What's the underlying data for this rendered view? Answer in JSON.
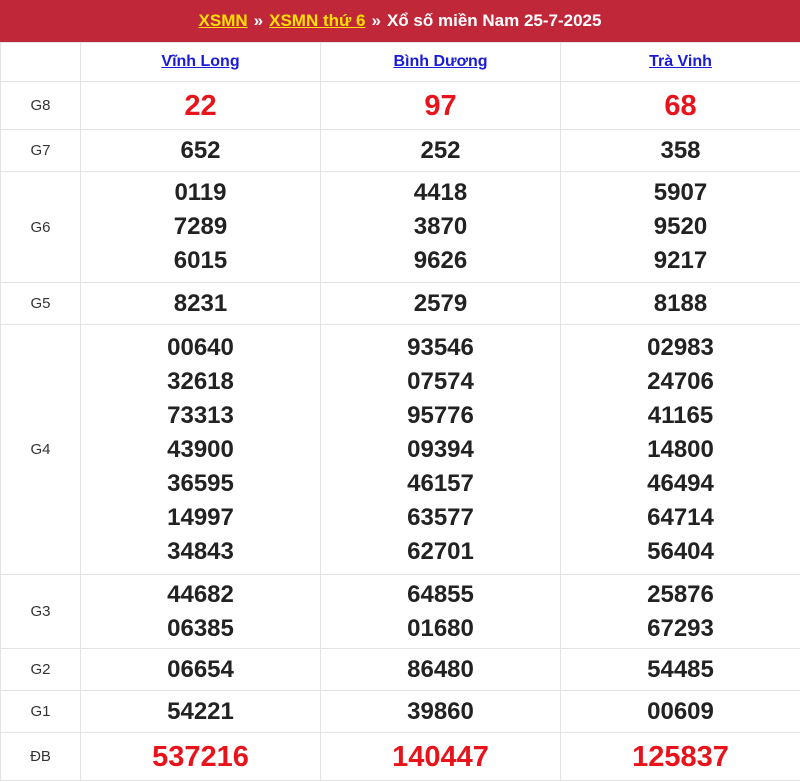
{
  "breadcrumb": {
    "link1": "XSMN",
    "sep1": "»",
    "link2": "XSMN thứ 6",
    "sep2": "»",
    "title": "Xổ số miền Nam 25-7-2025"
  },
  "provinces": [
    "Vĩnh Long",
    "Bình Dương",
    "Trà Vinh"
  ],
  "prizes": [
    {
      "label": "G8",
      "values": [
        [
          "22"
        ],
        [
          "97"
        ],
        [
          "68"
        ]
      ]
    },
    {
      "label": "G7",
      "values": [
        [
          "652"
        ],
        [
          "252"
        ],
        [
          "358"
        ]
      ]
    },
    {
      "label": "G6",
      "values": [
        [
          "0119",
          "7289",
          "6015"
        ],
        [
          "4418",
          "3870",
          "9626"
        ],
        [
          "5907",
          "9520",
          "9217"
        ]
      ]
    },
    {
      "label": "G5",
      "values": [
        [
          "8231"
        ],
        [
          "2579"
        ],
        [
          "8188"
        ]
      ]
    },
    {
      "label": "G4",
      "values": [
        [
          "00640",
          "32618",
          "73313",
          "43900",
          "36595",
          "14997",
          "34843"
        ],
        [
          "93546",
          "07574",
          "95776",
          "09394",
          "46157",
          "63577",
          "62701"
        ],
        [
          "02983",
          "24706",
          "41165",
          "14800",
          "46494",
          "64714",
          "56404"
        ]
      ]
    },
    {
      "label": "G3",
      "values": [
        [
          "44682",
          "06385"
        ],
        [
          "64855",
          "01680"
        ],
        [
          "25876",
          "67293"
        ]
      ]
    },
    {
      "label": "G2",
      "values": [
        [
          "06654"
        ],
        [
          "86480"
        ],
        [
          "54485"
        ]
      ]
    },
    {
      "label": "G1",
      "values": [
        [
          "54221"
        ],
        [
          "39860"
        ],
        [
          "00609"
        ]
      ]
    },
    {
      "label": "ĐB",
      "values": [
        [
          "537216"
        ],
        [
          "140447"
        ],
        [
          "125837"
        ]
      ]
    }
  ],
  "colors": {
    "header_bg": "#c0283a",
    "link_yellow": "#ffe000",
    "special_red": "#e8131b",
    "province_link": "#1a1adb"
  }
}
